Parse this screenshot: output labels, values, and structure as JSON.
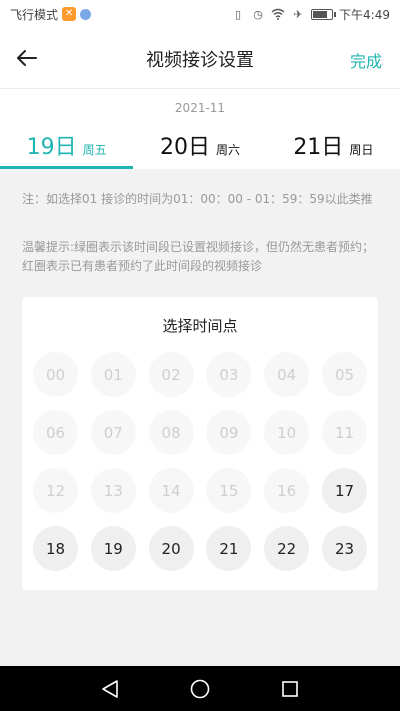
{
  "status_bar": {
    "airplane_mode": "飞行模式",
    "time": "下午4:49",
    "icons": [
      "vibrate-icon",
      "alarm-icon",
      "wifi-icon",
      "airplane-icon",
      "battery-icon"
    ]
  },
  "header": {
    "title": "视频接诊设置",
    "done_label": "完成",
    "back_icon": "back-arrow-icon"
  },
  "date": {
    "month": "2021-11",
    "days": [
      {
        "num": "19日",
        "weekday": "周五",
        "active": true
      },
      {
        "num": "20日",
        "weekday": "周六",
        "active": false
      },
      {
        "num": "21日",
        "weekday": "周日",
        "active": false
      }
    ]
  },
  "notes": {
    "note1": "注：如选择01 接诊的时间为01：00：00 - 01：59：59以此类推",
    "note2": "温馨提示:绿圈表示该时间段已设置视频接诊，但仍然无患者预约；红圈表示已有患者预约了此时间段的视频接诊"
  },
  "time_picker": {
    "title": "选择时间点",
    "slots": [
      {
        "label": "00",
        "available": false
      },
      {
        "label": "01",
        "available": false
      },
      {
        "label": "02",
        "available": false
      },
      {
        "label": "03",
        "available": false
      },
      {
        "label": "04",
        "available": false
      },
      {
        "label": "05",
        "available": false
      },
      {
        "label": "06",
        "available": false
      },
      {
        "label": "07",
        "available": false
      },
      {
        "label": "08",
        "available": false
      },
      {
        "label": "09",
        "available": false
      },
      {
        "label": "10",
        "available": false
      },
      {
        "label": "11",
        "available": false
      },
      {
        "label": "12",
        "available": false
      },
      {
        "label": "13",
        "available": false
      },
      {
        "label": "14",
        "available": false
      },
      {
        "label": "15",
        "available": false
      },
      {
        "label": "16",
        "available": false
      },
      {
        "label": "17",
        "available": true
      },
      {
        "label": "18",
        "available": true
      },
      {
        "label": "19",
        "available": true
      },
      {
        "label": "20",
        "available": true
      },
      {
        "label": "21",
        "available": true
      },
      {
        "label": "22",
        "available": true
      },
      {
        "label": "23",
        "available": true
      }
    ]
  },
  "colors": {
    "accent": "#1fb5b2",
    "disabled_text": "#cfcfcf",
    "available_bg": "#efefef"
  },
  "nav_bar": {
    "icons": [
      "back-triangle-icon",
      "home-circle-icon",
      "recents-square-icon"
    ]
  }
}
